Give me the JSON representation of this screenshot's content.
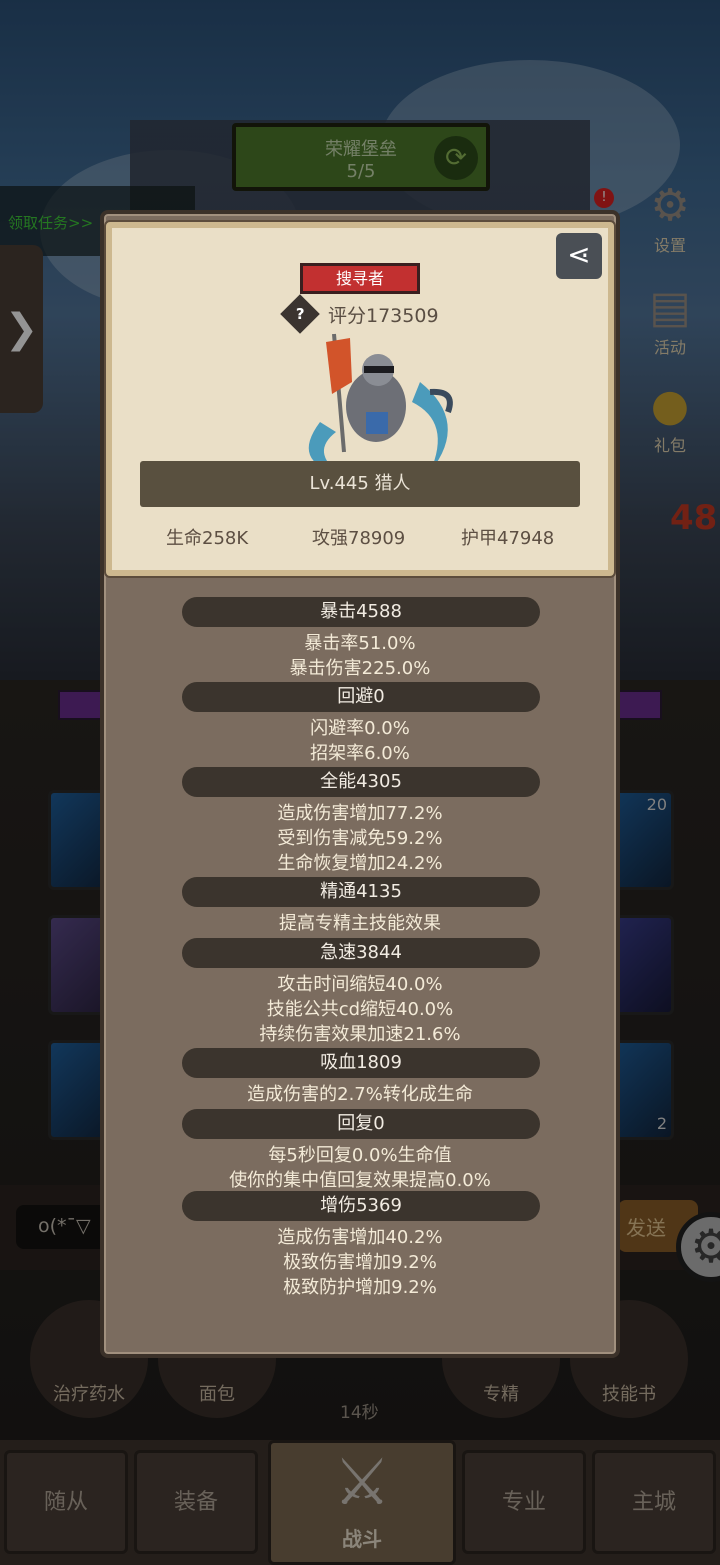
{
  "header": {
    "title": "荣耀堡垒",
    "count": "5/5"
  },
  "quest_link": "领取任务>>",
  "side_tab_arrow": "❯",
  "right_icons": [
    {
      "label": "设置",
      "icon": "gear-icon"
    },
    {
      "label": "活动",
      "icon": "scroll-icon"
    },
    {
      "label": "礼包",
      "icon": "gift-icon"
    }
  ],
  "alert_mark": "!",
  "side_number": "48",
  "slot_badges": {
    "top_right": "20",
    "bottom_right": "2"
  },
  "chat": {
    "input_text": "o(*ˉ▽",
    "send_label": "发送"
  },
  "quick_items": [
    "治疗药水",
    "面包",
    "专精",
    "技能书"
  ],
  "timer": "14秒",
  "nav": {
    "tabs": [
      "随从",
      "装备",
      "专业",
      "主城"
    ],
    "battle": "战斗"
  },
  "profile": {
    "class_badge": "搜寻者",
    "score_label": "评分173509",
    "level_text": "Lv.445 猎人",
    "stats": {
      "hp": "生命258K",
      "attack": "攻强78909",
      "armor": "护甲47948"
    }
  },
  "sections": [
    {
      "title": "暴击4588",
      "lines": [
        "暴击率51.0%",
        "暴击伤害225.0%"
      ]
    },
    {
      "title": "回避0",
      "lines": [
        "闪避率0.0%",
        "招架率6.0%"
      ]
    },
    {
      "title": "全能4305",
      "lines": [
        "造成伤害增加77.2%",
        "受到伤害减免59.2%",
        "生命恢复增加24.2%"
      ]
    },
    {
      "title": "精通4135",
      "lines": [
        "提高专精主技能效果"
      ]
    },
    {
      "title": "急速3844",
      "lines": [
        "攻击时间缩短40.0%",
        "技能公共cd缩短40.0%",
        "持续伤害效果加速21.6%"
      ]
    },
    {
      "title": "吸血1809",
      "lines": [
        "造成伤害的2.7%转化成生命"
      ]
    },
    {
      "title": "回复0",
      "lines": [
        "每5秒回复0.0%生命值",
        "使你的集中值回复效果提高0.0%"
      ]
    },
    {
      "title": "增伤5369",
      "lines": [
        "造成伤害增加40.2%",
        "极致伤害增加9.2%",
        "极致防护增加9.2%"
      ]
    }
  ]
}
